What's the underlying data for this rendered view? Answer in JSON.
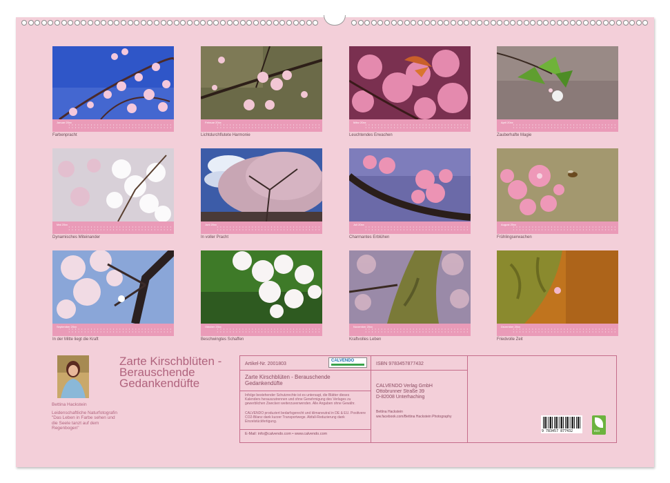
{
  "calendar": {
    "months": [
      {
        "month_label": "Januar 20xx",
        "caption": "Farbenpracht"
      },
      {
        "month_label": "Februar 20xx",
        "caption": "Lichtdurchflutete Harmonie"
      },
      {
        "month_label": "März 20xx",
        "caption": "Leuchtendes Erwachen"
      },
      {
        "month_label": "April 20xx",
        "caption": "Zauberhafte Magie"
      },
      {
        "month_label": "Mai 20xx",
        "caption": "Dynamisches Miteinander"
      },
      {
        "month_label": "Juni 20xx",
        "caption": "In voller Pracht"
      },
      {
        "month_label": "Juli 20xx",
        "caption": "Charmantes Erblühen"
      },
      {
        "month_label": "August 20xx",
        "caption": "Frühlingserwachen"
      },
      {
        "month_label": "September 20xx",
        "caption": "In der Mitte liegt die Kraft"
      },
      {
        "month_label": "Oktober 20xx",
        "caption": "Beschwingtes Schaffen"
      },
      {
        "month_label": "November 20xx",
        "caption": "Kraftvolles Leben"
      },
      {
        "month_label": "Dezember 20xx",
        "caption": "Friedvolle Zeit"
      }
    ]
  },
  "author": {
    "name": "Bettina Hackstein",
    "tagline": "Leidenschaftliche Naturfotografin \"Das Leben in Farbe sehen und die Seele tanzt auf dem Regenbogen\""
  },
  "title": "Zarte Kirschblüten - Berauschende Gedankendüfte",
  "info": {
    "article_no": "Artikel-Nr. 2001803",
    "calvendo_logo": "CALVENDO",
    "isbn": "ISBN 9783457877432",
    "book_title": "Zarte Kirschblüten - Berauschende Gedankendüfte",
    "publisher_name": "CALVENDO Verlag GmbH",
    "publisher_street": "Ottobrunner Straße 39",
    "publisher_city": "D-82008 Unterhaching",
    "legal_text_1": "Infolge bestehender Schutzrechte ist es untersagt, die Blätter dieses Kalenders herauszutrennen und ohne Genehmigung des Verlages zu gewerblichen Zwecken weiterzuverwenden. Alle Angaben ohne Gewähr.",
    "legal_text_2": "CALVENDO produziert bedarfsgerecht und klimaneutral in DE & EU. Positivere CO2-Bilanz dank kurzer Transportwege. Abfall-Reduzierung dank Einzelstückfertigung.",
    "contact": "E-Mail: info@calvendo.com • www.calvendo.com",
    "photographer_name": "Bettina Hackstein",
    "photographer_url": "ww.facebook.com/Bettina Hackstein Photography",
    "barcode_number": "9 783457 877432",
    "eco_label": "eco"
  },
  "colors": {
    "page_background": "#f3cfd9",
    "calendar_strip": "#ea9bb8",
    "accent_text": "#b0637d",
    "border": "#c46b8a"
  }
}
